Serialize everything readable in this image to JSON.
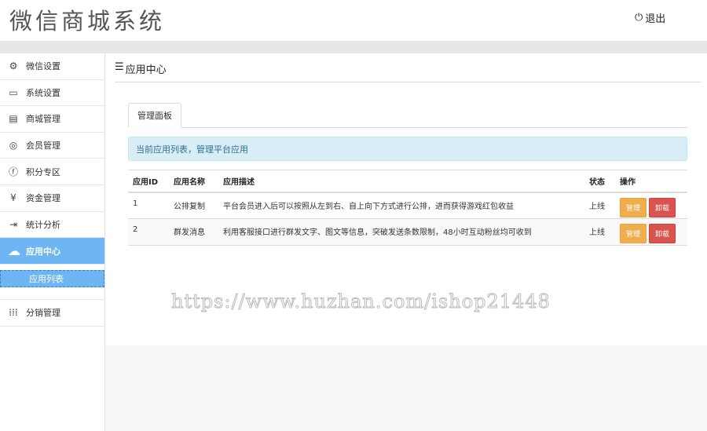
{
  "header": {
    "title": "微信商城系统",
    "logout": "退出"
  },
  "sidebar": {
    "items": [
      {
        "label": "微信设置",
        "icon": "gear-icon"
      },
      {
        "label": "系统设置",
        "icon": "monitor-icon"
      },
      {
        "label": "商城管理",
        "icon": "store-icon"
      },
      {
        "label": "会员管理",
        "icon": "user-icon"
      },
      {
        "label": "积分专区",
        "icon": "points-icon"
      },
      {
        "label": "资金管理",
        "icon": "yen-icon"
      },
      {
        "label": "统计分析",
        "icon": "login-icon"
      },
      {
        "label": "应用中心",
        "icon": "cloud-icon",
        "active": true
      },
      {
        "label": "分销管理",
        "icon": "grid-icon"
      }
    ],
    "sub_item": "应用列表"
  },
  "main": {
    "title": "应用中心",
    "tab": "管理面板",
    "alert": "当前应用列表，管理平台应用",
    "table": {
      "headers": [
        "应用ID",
        "应用名称",
        "应用描述",
        "状态",
        "操作"
      ],
      "rows": [
        {
          "id": "1",
          "name": "公排复制",
          "desc": "平台会员进入后可以按照从左到右、自上向下方式进行公排，进而获得游戏红包收益",
          "status": "上线",
          "manage": "管理",
          "uninstall": "卸载"
        },
        {
          "id": "2",
          "name": "群发消息",
          "desc": "利用客服接口进行群发文字、图文等信息，突破发送条数限制，48小时互动粉丝均可收到",
          "status": "上线",
          "manage": "管理",
          "uninstall": "卸载"
        }
      ]
    }
  },
  "watermark": "https://www.huzhan.com/ishop21448"
}
